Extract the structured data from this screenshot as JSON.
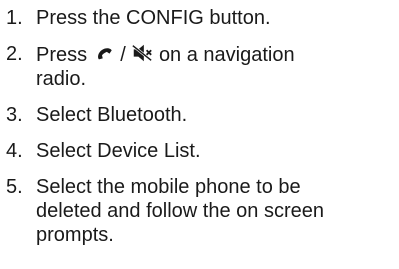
{
  "steps": [
    {
      "number": "1.",
      "text": "Press the CONFIG button."
    },
    {
      "number": "2.",
      "text_before": "Press",
      "separator": "/",
      "text_after": "on a navigation",
      "text_line2": "radio.",
      "icons": [
        "phone-icon",
        "mute-icon"
      ]
    },
    {
      "number": "3.",
      "text": "Select Bluetooth."
    },
    {
      "number": "4.",
      "text": "Select Device List."
    },
    {
      "number": "5.",
      "text_line1": "Select the mobile phone to be",
      "text_line2": "deleted and follow the on screen",
      "text_line3": "prompts."
    }
  ]
}
